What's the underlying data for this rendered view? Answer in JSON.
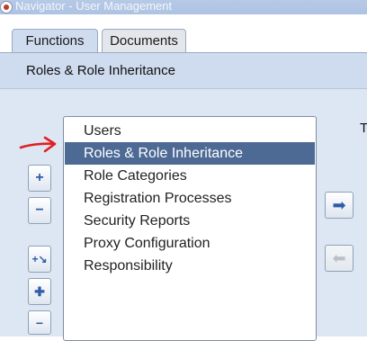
{
  "window": {
    "title": "Navigator - User Management"
  },
  "tabs": [
    {
      "label": "Functions",
      "active": true
    },
    {
      "label": "Documents",
      "active": false
    }
  ],
  "section": {
    "title": "Roles & Role Inheritance"
  },
  "list": {
    "items": [
      "Users",
      "Roles & Role Inheritance",
      "Role Categories",
      "Registration Processes",
      "Security Reports",
      "Proxy Configuration",
      "Responsibility"
    ],
    "selected_index": 1
  },
  "side_buttons": [
    {
      "icon": "expand-icon",
      "glyph": "+"
    },
    {
      "icon": "collapse-icon",
      "glyph": "−"
    },
    {
      "icon": "expand-branch-icon",
      "glyph": "+↘"
    },
    {
      "icon": "expand-all-icon",
      "glyph": "✚"
    },
    {
      "icon": "collapse-all-icon",
      "glyph": "−"
    }
  ],
  "right_buttons": [
    {
      "icon": "arrow-right-icon",
      "glyph": "➡",
      "enabled": true
    },
    {
      "icon": "arrow-left-icon",
      "glyph": "⬅",
      "enabled": false
    }
  ],
  "cut_label": "T",
  "annotation": {
    "color": "#e02020"
  }
}
